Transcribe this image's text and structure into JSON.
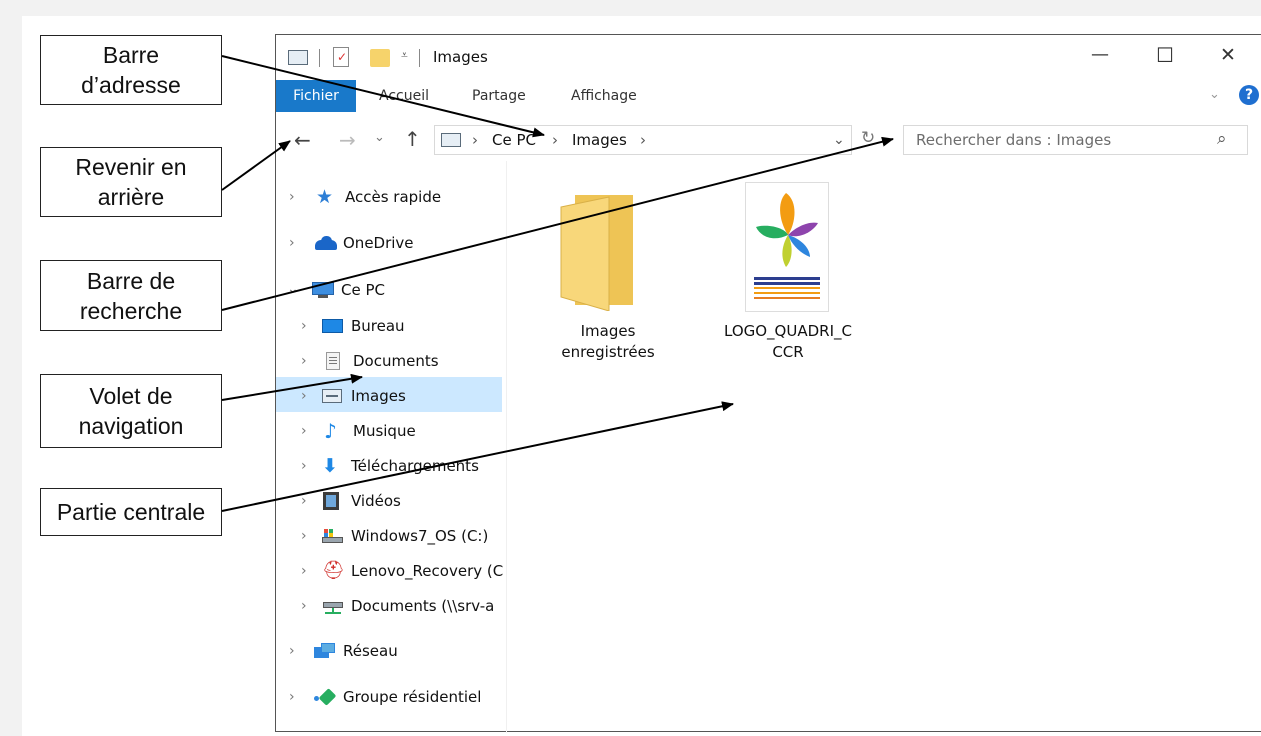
{
  "callouts": {
    "address_bar": "Barre\nd’adresse",
    "go_back": "Revenir en\narrière",
    "search_bar": "Barre de\nrecherche",
    "nav_pane": "Volet de\nnavigation",
    "central_part": "Partie centrale"
  },
  "window": {
    "title": "Images",
    "controls": {
      "minimize": "—",
      "maximize": "☐",
      "close": "✕"
    }
  },
  "ribbon": {
    "file_tab": "Fichier",
    "tabs": [
      "Accueil",
      "Partage",
      "Affichage"
    ]
  },
  "address": {
    "segments": [
      "Ce PC",
      "Images"
    ]
  },
  "search": {
    "placeholder": "Rechercher dans : Images"
  },
  "nav": {
    "top_items": [
      {
        "label": "Accès rapide",
        "icon": "star-icon"
      },
      {
        "label": "OneDrive",
        "icon": "cloud-icon"
      },
      {
        "label": "Ce PC",
        "icon": "computer-icon"
      }
    ],
    "pc_children": [
      {
        "label": "Bureau",
        "icon": "desktop-icon"
      },
      {
        "label": "Documents",
        "icon": "document-icon"
      },
      {
        "label": "Images",
        "icon": "pictures-icon"
      },
      {
        "label": "Musique",
        "icon": "music-icon"
      },
      {
        "label": "Téléchargements",
        "icon": "download-icon"
      },
      {
        "label": "Vidéos",
        "icon": "video-icon"
      },
      {
        "label": "Windows7_OS (C:)",
        "icon": "drive-icon"
      },
      {
        "label": "Lenovo_Recovery (C",
        "icon": "recovery-drive-icon"
      },
      {
        "label": "Documents (\\\\srv-a",
        "icon": "network-drive-icon"
      }
    ],
    "bottom_items": [
      {
        "label": "Réseau",
        "icon": "network-icon"
      },
      {
        "label": "Groupe résidentiel",
        "icon": "homegroup-icon"
      }
    ],
    "selected": "Images"
  },
  "content": {
    "items": [
      {
        "label_line1": "Images",
        "label_line2": "enregistrées",
        "icon": "folder-icon"
      },
      {
        "label_line1": "LOGO_QUADRI_C",
        "label_line2": "CCR",
        "icon": "image-file-icon"
      }
    ]
  },
  "colors": {
    "accent": "#1979ca",
    "selection": "#cce8ff",
    "folder": "#f6d36b",
    "help": "#1f6fd0"
  }
}
